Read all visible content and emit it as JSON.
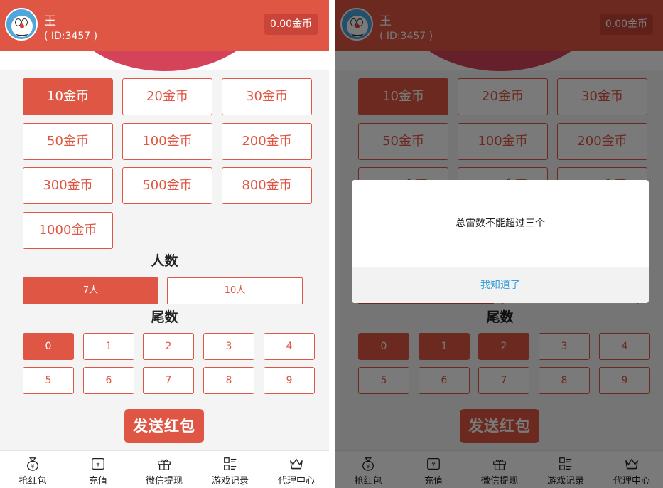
{
  "user": {
    "name": "王",
    "id_text": "( ID:3457 )",
    "balance": "0.00金币",
    "avatar_icon": "doraemon-avatar-icon"
  },
  "amounts": [
    "10金币",
    "20金币",
    "30金币",
    "50金币",
    "100金币",
    "200金币",
    "300金币",
    "500金币",
    "800金币",
    "1000金币"
  ],
  "people": {
    "title": "人数",
    "options": [
      "7人",
      "10人"
    ]
  },
  "tails": {
    "title": "尾数",
    "options": [
      "0",
      "1",
      "2",
      "3",
      "4",
      "5",
      "6",
      "7",
      "8",
      "9"
    ]
  },
  "send_button": "发送红包",
  "nav": [
    {
      "label": "抢红包",
      "icon": "money-bag-icon"
    },
    {
      "label": "充值",
      "icon": "recharge-icon"
    },
    {
      "label": "微信提现",
      "icon": "gift-icon"
    },
    {
      "label": "游戏记录",
      "icon": "record-list-icon"
    },
    {
      "label": "代理中心",
      "icon": "crown-icon"
    }
  ],
  "dialog": {
    "message": "总雷数不能超过三个",
    "confirm": "我知道了"
  },
  "colors": {
    "accent": "#df5744",
    "link": "#3aa0d8"
  },
  "states": {
    "left": {
      "amount_selected": [
        0
      ],
      "people_selected": 0,
      "tails_selected": [
        0
      ]
    },
    "right": {
      "amount_selected": [
        0
      ],
      "people_selected": 0,
      "tails_selected": [
        0,
        1,
        2
      ]
    }
  }
}
